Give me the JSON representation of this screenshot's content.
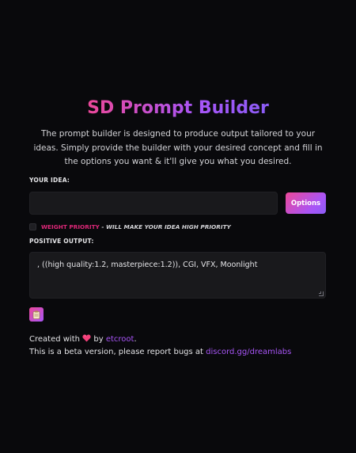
{
  "header": {
    "title": "SD Prompt Builder",
    "description": "The prompt builder is designed to produce output tailored to your ideas. Simply provide the builder with your desired concept and fill in the options you want & it'll give you what you desired."
  },
  "idea": {
    "label": "YOUR IDEA:",
    "value": "",
    "placeholder": ""
  },
  "options_button": {
    "label": "Options"
  },
  "weight_priority": {
    "checked": false,
    "label": "WEIGHT PRIORITY",
    "hint": " - WILL MAKE YOUR IDEA HIGH PRIORITY"
  },
  "output": {
    "label": "POSITIVE OUTPUT:",
    "value": ", ((high quality:1.2, masterpiece:1.2)), CGI, VFX, Moonlight"
  },
  "copy_button": {
    "icon": "clipboard-icon"
  },
  "footer": {
    "created_prefix": "Created with",
    "created_by": "by",
    "author": "etcroot",
    "created_suffix": ".",
    "beta_text": "This is a beta version, please report bugs at",
    "discord": "discord.gg/dreamlabs"
  },
  "colors": {
    "background": "#09090c",
    "accent_pink": "#ec4899",
    "accent_purple": "#a855f7",
    "field": "#19191c"
  }
}
